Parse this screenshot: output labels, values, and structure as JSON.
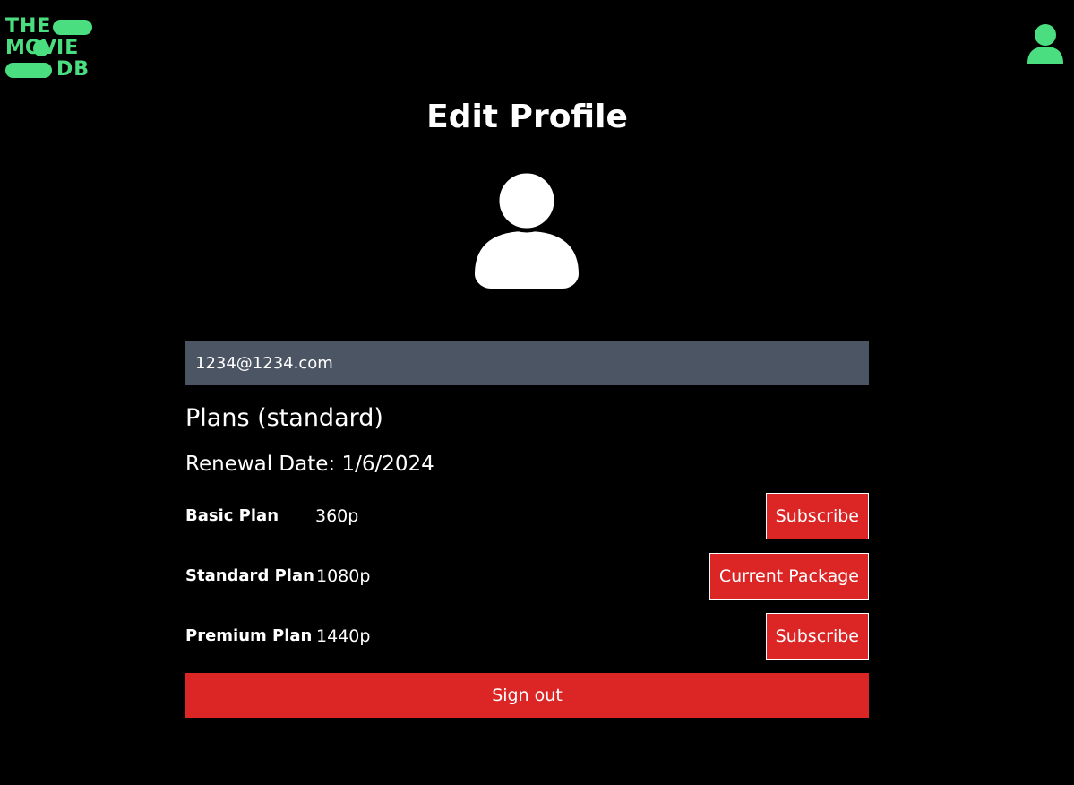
{
  "brand": {
    "logo_line1": "THE",
    "logo_line2_a": "MOV",
    "logo_line2_b": "IE",
    "logo_line3": "DB",
    "color": "#4ade80"
  },
  "header": {
    "profile_icon": "user-icon"
  },
  "page": {
    "title": "Edit Profile",
    "avatar_icon": "user-icon"
  },
  "form": {
    "email_value": "1234@1234.com"
  },
  "plans": {
    "heading": "Plans (standard)",
    "renewal": "Renewal Date: 1/6/2024",
    "items": [
      {
        "name": "Basic Plan",
        "resolution": "360p",
        "action": "Subscribe"
      },
      {
        "name": "Standard Plan",
        "resolution": "1080p",
        "action": "Current Package"
      },
      {
        "name": "Premium Plan",
        "resolution": "1440p",
        "action": "Subscribe"
      }
    ]
  },
  "signout_label": "Sign out",
  "colors": {
    "background": "#000000",
    "accent_red": "#dc2626",
    "input_bg": "#4b5563"
  }
}
